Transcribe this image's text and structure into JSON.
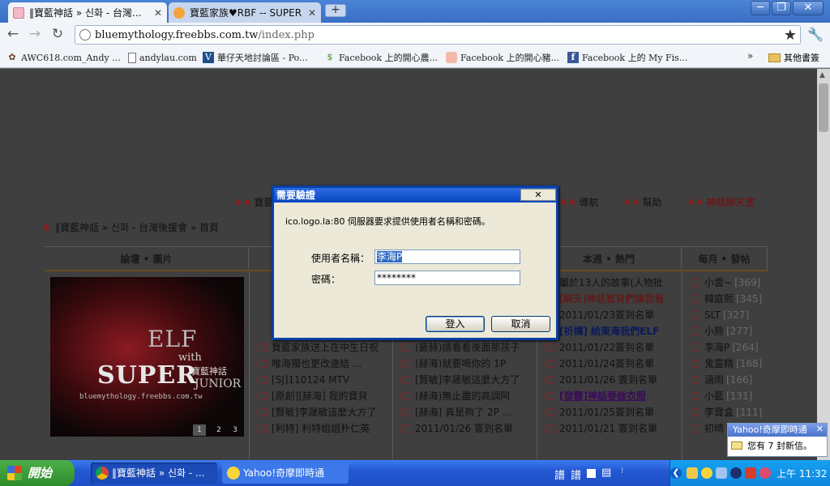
{
  "browser": {
    "tabs": [
      {
        "title": "‖寶藍神話 » 신화 - 台灣...",
        "active": true
      },
      {
        "title": "寶藍家族♥RBF -- SUPER ...",
        "active": false
      }
    ],
    "new_tab": "+",
    "window": {
      "minimize": "─",
      "maximize": "❐",
      "close": "✕"
    },
    "url_host": "bluemythology.freebbs.com.tw",
    "url_path": "/index.php",
    "nav": {
      "back": "←",
      "forward": "→",
      "reload": "↻",
      "star": "★",
      "wrench": "🔧"
    },
    "bookmarks": [
      {
        "label": "AWC618.com_Andy ...",
        "icon": "globe-icon"
      },
      {
        "label": "andylau.com",
        "icon": "page-icon"
      },
      {
        "label": "華仔天地討論區 - Po...",
        "icon": "vbulletin-icon"
      },
      {
        "label": "Facebook 上的開心農...",
        "icon": "farm-icon"
      },
      {
        "label": "Facebook 上的開心豬...",
        "icon": "pig-icon"
      },
      {
        "label": "Facebook 上的 My Fis...",
        "icon": "facebook-icon"
      }
    ],
    "bookmarks_more": "»",
    "other_bookmarks": "其他書簽"
  },
  "site": {
    "nav_links": [
      {
        "label": "寶藍",
        "red": false
      },
      {
        "label": "導航",
        "red": false
      },
      {
        "label": "幫助",
        "red": false
      },
      {
        "label": "神話聊天室",
        "red": true
      }
    ],
    "breadcrumb": "‖寶藍神話 » 신화 - 台灣後援會 » 首頁",
    "columns": [
      "論壇 • 圖片",
      "本週 • 熱門",
      "每月 • 發帖"
    ],
    "banner": {
      "line1": "ELF",
      "line2": "with",
      "line3": "SUPER",
      "line4": "JUNIOR",
      "line5": "寶藍神話",
      "site": "bluemythology.freebbs.com.tw"
    },
    "pager": [
      "1",
      "2",
      "3"
    ],
    "col2": [
      "寶藍家族送上在中生日祝",
      "唯海獨也更改連結 ...",
      "[SJ]110124 MTV",
      "[原創][赫海] 我的寶貝",
      "[賢敏]李晟敏這麼大方了",
      "[利特] 利特姐姐朴仁英"
    ],
    "col3": [
      "(藝赫)請看看後面那孩子",
      "(赫海)就要喝你的 1P",
      "[賢敏]李晟敏這麼大方了",
      "(赫海)無止盡的高調阿",
      "[赫海] 真是夠了 2P ...",
      "2011/01/26 簽到名單"
    ],
    "col4": [
      {
        "text": "屬於13人的故事(人物批",
        "style": ""
      },
      {
        "text": "[聊天]神話寶貝們讓我看",
        "style": "red"
      },
      {
        "text": "2011/01/23簽到名單",
        "style": ""
      },
      {
        "text": "[祈禱] 給東海我們ELF",
        "style": "blue"
      },
      {
        "text": "2011/01/22簽到名單",
        "style": ""
      },
      {
        "text": "2011/01/24簽到名單",
        "style": ""
      },
      {
        "text": "2011/01/26 簽到名單",
        "style": ""
      },
      {
        "text": "[發襲]神話要做衣服",
        "style": "purple"
      },
      {
        "text": "2011/01/25簽到名單",
        "style": ""
      },
      {
        "text": "2011/01/21 簽到名單",
        "style": ""
      }
    ],
    "col5": [
      {
        "name": "小雲~",
        "count": "[369]"
      },
      {
        "name": "韓庭熙",
        "count": "[345]"
      },
      {
        "name": "SLT",
        "count": "[327]"
      },
      {
        "name": "小熊",
        "count": "[277]"
      },
      {
        "name": "李海P",
        "count": "[264]"
      },
      {
        "name": "鬼靈精",
        "count": "[168]"
      },
      {
        "name": "涵雨",
        "count": "[166]"
      },
      {
        "name": "小藍",
        "count": "[131]"
      },
      {
        "name": "李寶盒",
        "count": "[111]"
      },
      {
        "name": "初晴",
        "count": ""
      }
    ]
  },
  "dialog": {
    "title": "需要驗證",
    "close": "✕",
    "message": "ico.logo.la:80 伺服器要求提供使用者名稱和密碼。",
    "username_label": "使用者名稱：",
    "username_value": "李海P",
    "password_label": "密碼：",
    "password_value": "********",
    "login": "登入",
    "cancel": "取消"
  },
  "notification": {
    "title": "Yahoo!奇摩即時通",
    "close": "✕",
    "message": "您有 7 封新信。"
  },
  "taskbar": {
    "start": "開始",
    "tasks": [
      {
        "label": "‖寶藍神話 » 신화 - ...",
        "icon": "chrome-icon"
      },
      {
        "label": "Yahoo!奇摩即時通",
        "icon": "yahoo-messenger-icon"
      }
    ],
    "ime": [
      "譜",
      "譜"
    ],
    "clock": "上午 11:32"
  },
  "colors": {
    "accent": "#2459d4",
    "dialog_title": "#0a46c4",
    "page_dim": "#3f3f3f"
  }
}
